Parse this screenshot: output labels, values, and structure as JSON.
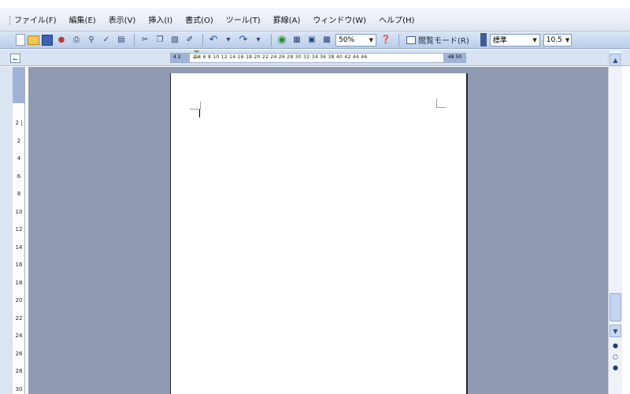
{
  "menubar": {
    "items": [
      "ファイル(F)",
      "編集(E)",
      "表示(V)",
      "挿入(I)",
      "書式(O)",
      "ツール(T)",
      "罫線(A)",
      "ウィンドウ(W)",
      "ヘルプ(H)"
    ]
  },
  "toolbar": {
    "zoom": "50%",
    "reading_mode_label": "閲覧モード(R)",
    "style_value": "標準",
    "font_size_value": "10.5"
  },
  "ruler": {
    "left_numbers": "4 2",
    "ticks": "2 4 6 8 10 12 14 16 18 20 22 24 26 28 30 32 34 36 38 40 42 44 46",
    "right_numbers": "48 50"
  },
  "vertical_ruler": {
    "numbers": "2 | 2 4 6 8 10 12 14 16 18 20 22 24 26 28 30"
  },
  "icons": [
    "new-document-icon",
    "open-folder-icon",
    "save-icon",
    "permission-icon",
    "print-icon",
    "print-preview-icon",
    "spelling-icon",
    "research-icon",
    "cut-icon",
    "copy-icon",
    "paste-icon",
    "format-painter-icon",
    "undo-icon",
    "redo-icon",
    "hyperlink-icon",
    "tables-borders-icon",
    "insert-table-icon",
    "insert-excel-icon",
    "help-icon"
  ]
}
